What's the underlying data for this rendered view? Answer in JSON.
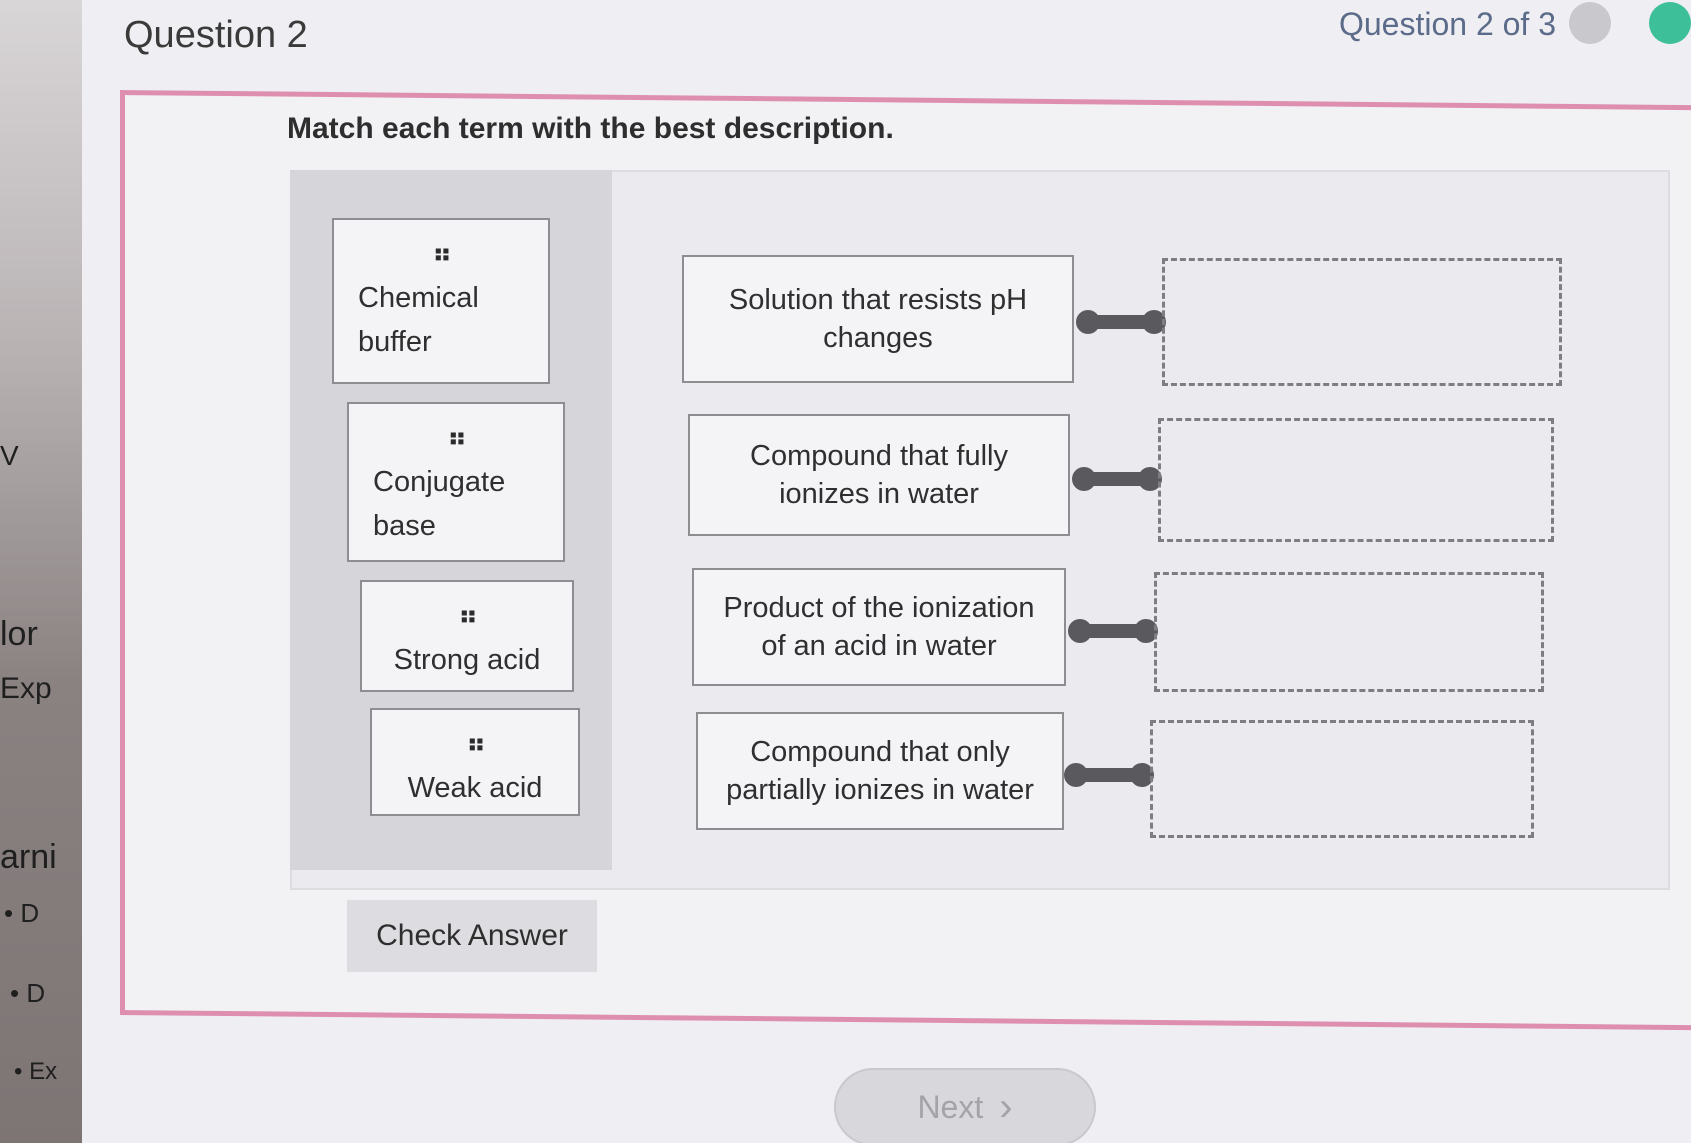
{
  "background_app": {
    "fragments": [
      "V",
      "lor",
      "Exp",
      "arni",
      "• D",
      "• D",
      "• Ex"
    ]
  },
  "header": {
    "title": "Question 2",
    "progress": "Question 2 of 3"
  },
  "instruction": "Match each term with the best description.",
  "terms": [
    {
      "label": "Chemical buffer",
      "line1": "Chemical",
      "line2": "buffer"
    },
    {
      "label": "Conjugate base",
      "line1": "Conjugate",
      "line2": "base"
    },
    {
      "label": "Strong acid"
    },
    {
      "label": "Weak acid"
    }
  ],
  "descriptions": [
    {
      "line1": "Solution that resists pH",
      "line2": "changes"
    },
    {
      "line1": "Compound that fully",
      "line2": "ionizes in water"
    },
    {
      "line1": "Product of the ionization",
      "line2": "of an acid in water"
    },
    {
      "line1": "Compound that only",
      "line2": "partially ionizes in water"
    }
  ],
  "handle_glyph": "⠶",
  "buttons": {
    "check_answer": "Check Answer",
    "next": "Next",
    "next_chevron": "›"
  },
  "colors": {
    "panel_border": "#de8fb0",
    "progress_text": "#5b6b8a",
    "progress_dot_done": "#c9c8cc",
    "progress_dot_current": "#3dbf9a"
  }
}
